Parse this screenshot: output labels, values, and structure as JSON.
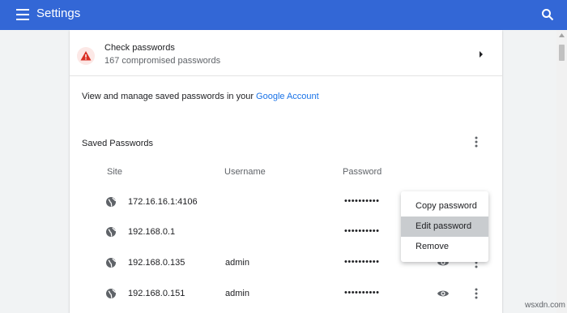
{
  "header": {
    "title": "Settings"
  },
  "check": {
    "title": "Check passwords",
    "subtitle": "167 compromised passwords"
  },
  "manage": {
    "text": "View and manage saved passwords in your ",
    "link": "Google Account"
  },
  "saved": {
    "label": "Saved Passwords",
    "columns": {
      "site": "Site",
      "username": "Username",
      "password": "Password"
    },
    "rows": [
      {
        "site": "172.16.16.1:4106",
        "username": "",
        "password": "••••••••••"
      },
      {
        "site": "192.168.0.1",
        "username": "",
        "password": "••••••••••"
      },
      {
        "site": "192.168.0.135",
        "username": "admin",
        "password": "••••••••••"
      },
      {
        "site": "192.168.0.151",
        "username": "admin",
        "password": "••••••••••"
      }
    ]
  },
  "context_menu": {
    "items": [
      "Copy password",
      "Edit password",
      "Remove"
    ],
    "highlighted": "Edit password"
  },
  "watermark": "wsxdn.com",
  "icons": [
    "menu-icon",
    "search-icon",
    "warning-icon",
    "chevron-right-icon",
    "more-vert-icon",
    "globe-icon",
    "eye-icon"
  ],
  "colors": {
    "header": "#3367d6",
    "link": "#1a73e8",
    "warning": "#d93025",
    "highlight": "#c9cccf"
  }
}
